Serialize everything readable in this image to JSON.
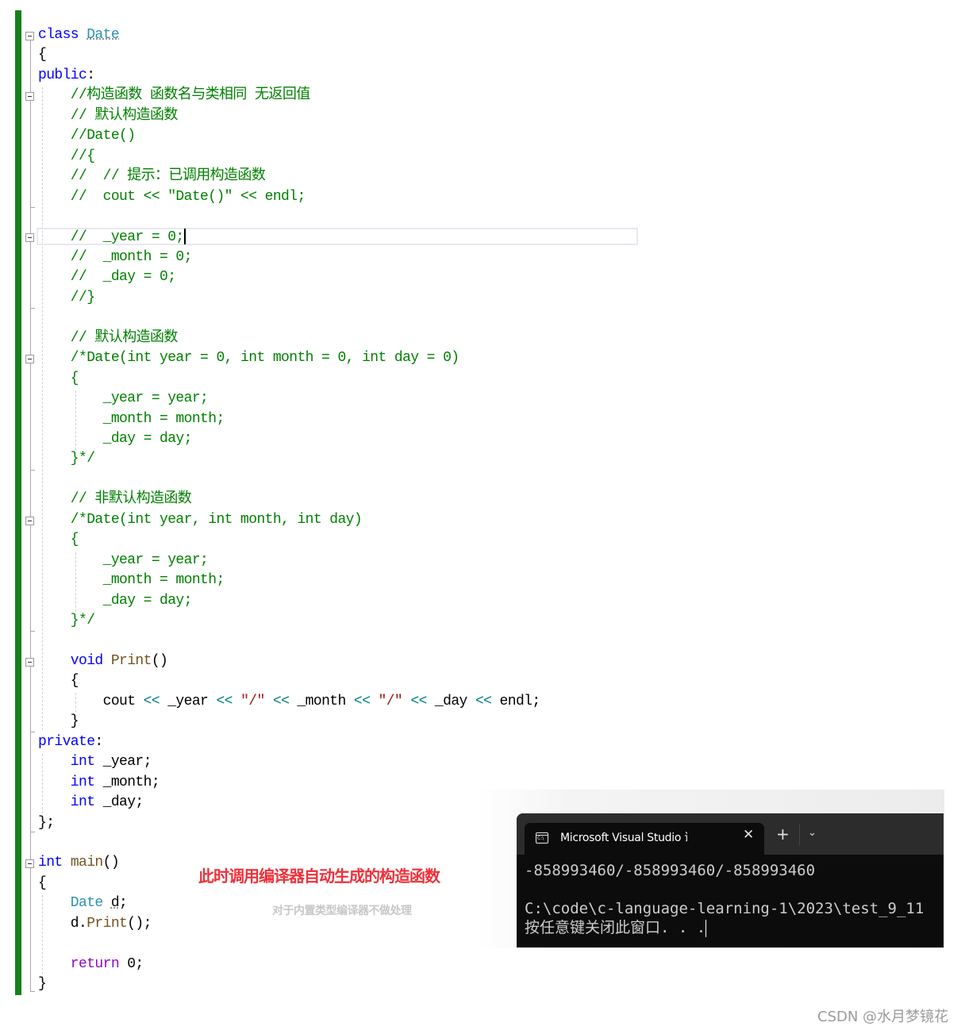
{
  "editor": {
    "lines": [
      {
        "segments": [
          [
            "kw",
            "class "
          ],
          [
            "ty sq",
            "Date"
          ]
        ]
      },
      {
        "segments": [
          [
            "",
            "{"
          ]
        ]
      },
      {
        "segments": [
          [
            "kw",
            "public"
          ],
          [
            "",
            ":"
          ]
        ]
      },
      {
        "segments": [
          [
            "cm",
            "    //构造函数 函数名与类相同 无返回值"
          ]
        ]
      },
      {
        "segments": [
          [
            "cm",
            "    // 默认构造函数"
          ]
        ]
      },
      {
        "segments": [
          [
            "cm",
            "    //Date()"
          ]
        ]
      },
      {
        "segments": [
          [
            "cm",
            "    //{"
          ]
        ]
      },
      {
        "segments": [
          [
            "cm",
            "    //  // 提示：已调用构造函数"
          ]
        ]
      },
      {
        "segments": [
          [
            "cm",
            "    //  cout << \"Date()\" << endl;"
          ]
        ]
      },
      {
        "segments": []
      },
      {
        "segments": [
          [
            "cm",
            "    //  _year = 0;"
          ]
        ],
        "caret": true
      },
      {
        "segments": [
          [
            "cm",
            "    //  _month = 0;"
          ]
        ]
      },
      {
        "segments": [
          [
            "cm",
            "    //  _day = 0;"
          ]
        ]
      },
      {
        "segments": [
          [
            "cm",
            "    //}"
          ]
        ]
      },
      {
        "segments": []
      },
      {
        "segments": [
          [
            "cm",
            "    // 默认构造函数"
          ]
        ]
      },
      {
        "segments": [
          [
            "cm",
            "    /*Date(int year = 0, int month = 0, int day = 0)"
          ]
        ]
      },
      {
        "segments": [
          [
            "cm",
            "    {"
          ]
        ]
      },
      {
        "segments": [
          [
            "cm",
            "        _year = year;"
          ]
        ]
      },
      {
        "segments": [
          [
            "cm",
            "        _month = month;"
          ]
        ]
      },
      {
        "segments": [
          [
            "cm",
            "        _day = day;"
          ]
        ]
      },
      {
        "segments": [
          [
            "cm",
            "    }*/"
          ]
        ]
      },
      {
        "segments": []
      },
      {
        "segments": [
          [
            "cm",
            "    // 非默认构造函数"
          ]
        ]
      },
      {
        "segments": [
          [
            "cm",
            "    /*Date(int year, int month, int day)"
          ]
        ]
      },
      {
        "segments": [
          [
            "cm",
            "    {"
          ]
        ]
      },
      {
        "segments": [
          [
            "cm",
            "        _year = year;"
          ]
        ]
      },
      {
        "segments": [
          [
            "cm",
            "        _month = month;"
          ]
        ]
      },
      {
        "segments": [
          [
            "cm",
            "        _day = day;"
          ]
        ]
      },
      {
        "segments": [
          [
            "cm",
            "    }*/"
          ]
        ]
      },
      {
        "segments": []
      },
      {
        "segments": [
          [
            "kw",
            "    void "
          ],
          [
            "fn",
            "Print"
          ],
          [
            "",
            "()"
          ]
        ]
      },
      {
        "segments": [
          [
            "",
            "    {"
          ]
        ]
      },
      {
        "segments": [
          [
            "",
            "        cout "
          ],
          [
            "op",
            "<<"
          ],
          [
            "",
            " _year "
          ],
          [
            "op",
            "<<"
          ],
          [
            "",
            " "
          ],
          [
            "st",
            "\"/\""
          ],
          [
            "",
            " "
          ],
          [
            "op",
            "<<"
          ],
          [
            "",
            " _month "
          ],
          [
            "op",
            "<<"
          ],
          [
            "",
            " "
          ],
          [
            "st",
            "\"/\""
          ],
          [
            "",
            " "
          ],
          [
            "op",
            "<<"
          ],
          [
            "",
            " _day "
          ],
          [
            "op",
            "<<"
          ],
          [
            "",
            " endl;"
          ]
        ]
      },
      {
        "segments": [
          [
            "",
            "    }"
          ]
        ]
      },
      {
        "segments": [
          [
            "kw",
            "private"
          ],
          [
            "",
            ":"
          ]
        ]
      },
      {
        "segments": [
          [
            "kw",
            "    int"
          ],
          [
            "",
            " _year;"
          ]
        ]
      },
      {
        "segments": [
          [
            "kw",
            "    int"
          ],
          [
            "",
            " _month;"
          ]
        ]
      },
      {
        "segments": [
          [
            "kw",
            "    int"
          ],
          [
            "",
            " _day;"
          ]
        ]
      },
      {
        "segments": [
          [
            "",
            "};"
          ]
        ]
      },
      {
        "segments": []
      },
      {
        "segments": [
          [
            "kw",
            "int "
          ],
          [
            "fn",
            "main"
          ],
          [
            "",
            "()"
          ]
        ]
      },
      {
        "segments": [
          [
            "",
            "{"
          ]
        ]
      },
      {
        "segments": [
          [
            "ty",
            "    Date "
          ],
          [
            "sq",
            "d"
          ],
          [
            "",
            ";"
          ]
        ]
      },
      {
        "segments": [
          [
            "",
            "    d."
          ],
          [
            "fn",
            "Print"
          ],
          [
            "",
            "();"
          ]
        ]
      },
      {
        "segments": []
      },
      {
        "segments": [
          [
            "ret",
            "    return "
          ],
          [
            "",
            "0;"
          ]
        ]
      },
      {
        "segments": [
          [
            "",
            "}"
          ]
        ]
      }
    ]
  },
  "annotations": {
    "primary": "此时调用编译器自动生成的构造函数",
    "secondary": "对于内置类型编译器不做处理"
  },
  "terminal": {
    "tab_icon": "console-icon",
    "tab_icon_text": "C:\\",
    "tab_title": "Microsoft Visual Studio 调试控制台",
    "close_glyph": "✕",
    "new_tab_glyph": "+",
    "dropdown_glyph": "⌄",
    "output_lines": [
      "-858993460/-858993460/-858993460",
      "",
      "C:\\code\\c-language-learning-1\\2023\\test_9_11",
      "按任意键关闭此窗口. . ."
    ]
  },
  "watermark": "CSDN @水月梦镜花"
}
